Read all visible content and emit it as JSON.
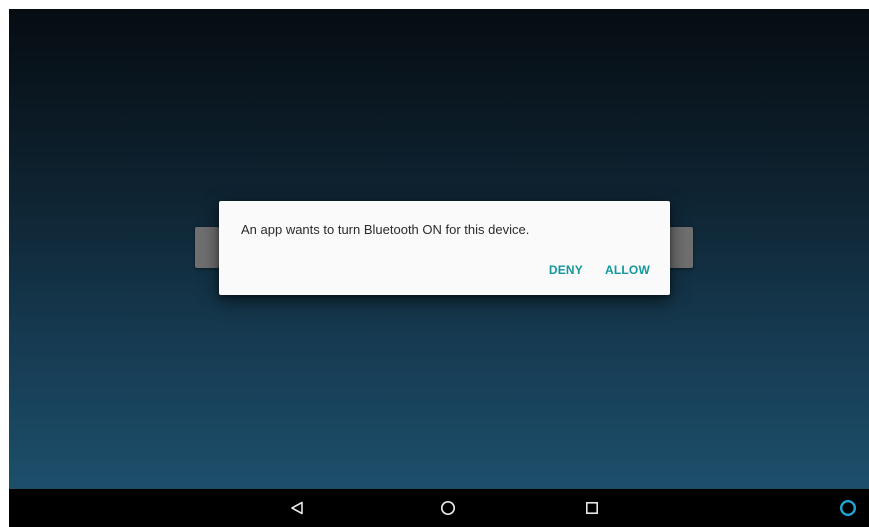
{
  "dialog": {
    "message": "An app wants to turn Bluetooth ON for this device.",
    "deny_label": "DENY",
    "allow_label": "ALLOW"
  },
  "navbar": {
    "buttons": [
      {
        "id": "back",
        "icon": "back-triangle-icon"
      },
      {
        "id": "home",
        "icon": "home-circle-icon"
      },
      {
        "id": "recents",
        "icon": "recents-square-icon"
      },
      {
        "id": "assistant",
        "icon": "alexa-ring-icon"
      }
    ]
  },
  "colors": {
    "accent": "#12989a",
    "assistant": "#1fa8d8",
    "wallpaper_top": "#060c12",
    "wallpaper_bottom": "#1d4f6b",
    "dialog_background": "#fafafa",
    "navbar_background": "#000000"
  }
}
